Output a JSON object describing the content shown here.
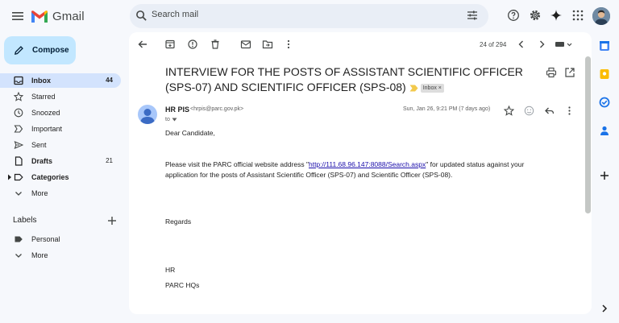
{
  "app": {
    "name": "Gmail"
  },
  "search": {
    "placeholder": "Search mail"
  },
  "compose": {
    "label": "Compose"
  },
  "nav": [
    {
      "label": "Inbox",
      "count": "44",
      "icon": "inbox-icon"
    },
    {
      "label": "Starred",
      "count": "",
      "icon": "star-icon"
    },
    {
      "label": "Snoozed",
      "count": "",
      "icon": "clock-icon"
    },
    {
      "label": "Important",
      "count": "",
      "icon": "important-icon"
    },
    {
      "label": "Sent",
      "count": "",
      "icon": "send-icon"
    },
    {
      "label": "Drafts",
      "count": "21",
      "icon": "draft-icon"
    },
    {
      "label": "Categories",
      "count": "",
      "icon": "label-outline-icon"
    },
    {
      "label": "More",
      "count": "",
      "icon": "chevron-down-icon"
    }
  ],
  "labels": {
    "title": "Labels",
    "items": [
      {
        "label": "Personal",
        "icon": "label-icon"
      },
      {
        "label": "More",
        "icon": "chevron-down-icon"
      }
    ]
  },
  "toolbar": {
    "pager": "24 of 294"
  },
  "email": {
    "subject": "INTERVIEW FOR THE POSTS OF ASSISTANT SCIENTIFIC OFFICER (SPS-07) AND SCIENTIFIC OFFICER (SPS-08)",
    "inbox_chip": "Inbox",
    "inbox_chip_close": "×",
    "sender_name": "HR PIS",
    "sender_email": "<hrpis@parc.gov.pk>",
    "to": "to",
    "date": "Sun, Jan 26, 9:21 PM (7 days ago)",
    "greeting": "Dear Candidate,",
    "body_pre": "Please visit the PARC official website address \"",
    "link": "http://111.68.96.147:8088/Search.aspx",
    "body_post": "\" for updated status against your",
    "body_line2": "application for the posts of Assistant Scientific Officer (SPS-07) and Scientific Officer (SPS-08).",
    "regards": "Regards",
    "sig1": "HR",
    "sig2": "PARC HQs"
  },
  "colors": {
    "accent": "#c2e7ff",
    "active_nav": "#d3e3fd",
    "background": "#f6f8fc"
  }
}
